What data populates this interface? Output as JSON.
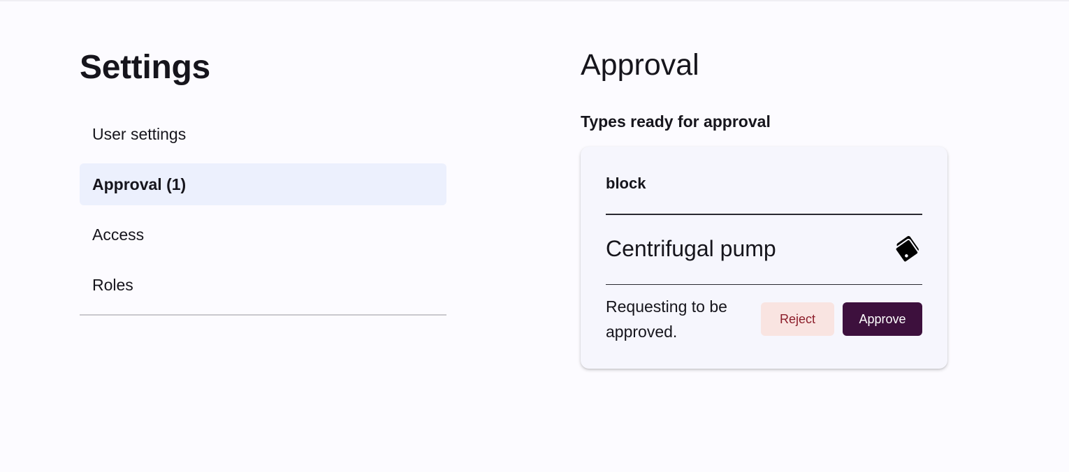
{
  "settings": {
    "title": "Settings",
    "nav": [
      {
        "label": "User settings",
        "active": false
      },
      {
        "label": "Approval (1)",
        "active": true
      },
      {
        "label": "Access",
        "active": false
      },
      {
        "label": "Roles",
        "active": false
      }
    ]
  },
  "approval": {
    "title": "Approval",
    "subtitle": "Types ready for approval",
    "card": {
      "type": "block",
      "name": "Centrifugal pump",
      "icon": "tags-icon",
      "status": "Requesting to be approved.",
      "reject_label": "Reject",
      "approve_label": "Approve"
    }
  },
  "colors": {
    "background": "#fcfbff",
    "active_nav": "#ecf0fd",
    "card_background": "#f6f6fd",
    "reject_bg": "#f9e4e1",
    "reject_text": "#8c1d2a",
    "approve_bg": "#3d103d"
  }
}
